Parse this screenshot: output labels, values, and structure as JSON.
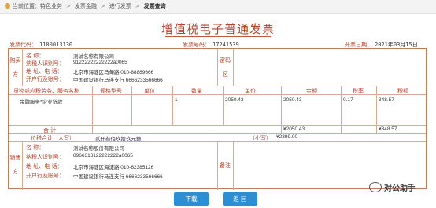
{
  "breadcrumb": {
    "items": [
      "当前位置：特色业务",
      "发票金融",
      "进行发票",
      "发票查询"
    ]
  },
  "invoice": {
    "title": "增值税电子普通发票",
    "code_label": "发票代码：",
    "code": "1100013130",
    "number_label": "发票号码：",
    "number": "17241539",
    "date_label": "开票日期：",
    "date": "2021年03月15日",
    "buyer": {
      "side_label": [
        "购买",
        "方"
      ],
      "name_label": "名      称：",
      "name": "测试名称有限公司",
      "taxid_label": "纳税人识别号：",
      "taxid": "91222222222222a0065",
      "addr_label": "地 址、电 话：",
      "addr": "北京市海淀区马甸路 010-88889666",
      "bank_label": "开户行及账号：",
      "bank": "中国建设银行马连支行 6666233566666"
    },
    "cipher_label": [
      "密码",
      "区"
    ],
    "columns": [
      "货物或应税劳务、服务名称",
      "规格型号",
      "单位",
      "数量",
      "单价",
      "金额",
      "税率",
      "税额"
    ],
    "item": {
      "name": "金融服务*企业贷款",
      "spec": "",
      "unit": "",
      "qty": "1",
      "price": "2050.43",
      "amount": "2050.43",
      "rate": "0.17",
      "tax": "348.57"
    },
    "total_label": "合    计",
    "total_amount": "¥2050.43",
    "total_tax": "¥348.57",
    "grand_label": "价税合计（大写）",
    "grand_words": "贰仟叁佰玖拾玖元整",
    "grand_small_label": "（小写）",
    "grand_small": "¥2399.00",
    "seller": {
      "side_label": [
        "销售",
        "方"
      ],
      "name_label": "名      称：",
      "name": "测试名称股份有限公司",
      "taxid_label": "纳税人识别号：",
      "taxid": "8966313122222222a0065",
      "addr_label": "地 址、电 话：",
      "addr": "北京市海淀区海淀路 010-62385126",
      "bank_label": "开户行及账号：",
      "bank": "中国建设银行马连支行 6666233566666"
    },
    "remark_label": "备注"
  },
  "buttons": {
    "download": "下载",
    "back": "返 回"
  },
  "watermark": "对公助手"
}
